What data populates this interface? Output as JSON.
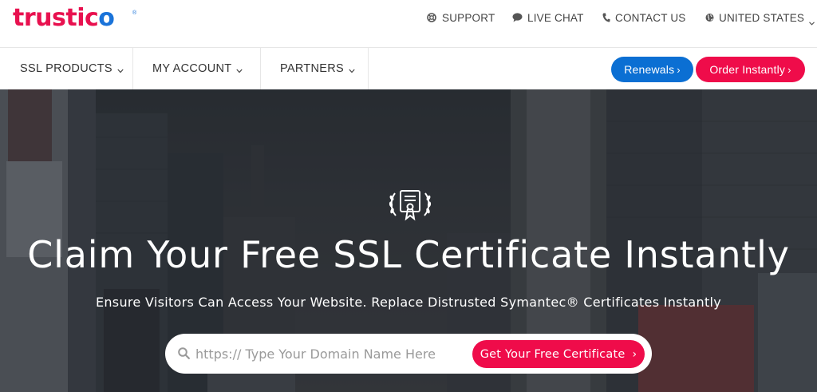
{
  "brand": {
    "logo_main": "trustic",
    "logo_accent": "o",
    "logo_mark": "®"
  },
  "utility_nav": {
    "support": "SUPPORT",
    "live_chat": "LIVE CHAT",
    "contact_us": "CONTACT US",
    "country": "UNITED STATES"
  },
  "main_nav": {
    "items": [
      {
        "label": "SSL PRODUCTS"
      },
      {
        "label": "MY ACCOUNT"
      },
      {
        "label": "PARTNERS"
      }
    ],
    "renewals": "Renewals",
    "order": "Order Instantly",
    "chevron": "›"
  },
  "hero": {
    "title": "Claim Your Free SSL Certificate Instantly",
    "subtitle": "Ensure Visitors Can Access Your Website. Replace Distrusted Symantec® Certificates Instantly",
    "search_placeholder": "https:// Type Your Domain Name Here",
    "search_value": "",
    "cta": "Get Your Free Certificate",
    "cta_chevron": "›"
  },
  "colors": {
    "brand_red": "#ef0c4a",
    "brand_blue": "#0b6fd3",
    "logo_red": "#e8114f",
    "logo_blue": "#1a73d9"
  },
  "icons": {
    "support": "lifebuoy-icon",
    "chat": "chat-bubble-icon",
    "contact": "phone-icon",
    "country": "globe-icon",
    "hero": "certificate-award-icon",
    "search": "search-icon"
  }
}
